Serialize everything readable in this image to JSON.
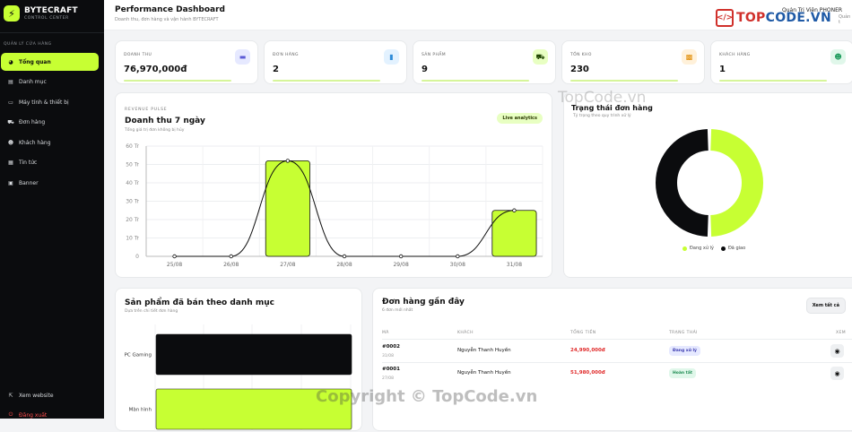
{
  "sidebar": {
    "brand_name": "BYTECRAFT",
    "brand_sub": "CONTROL CENTER",
    "logo_glyph": "⚡",
    "section_label": "QUẢN LÝ CỬA HÀNG",
    "items": [
      {
        "label": "Tổng quan",
        "icon": "pie-chart-icon",
        "glyph": "◕",
        "active": true
      },
      {
        "label": "Danh mục",
        "icon": "folder-icon",
        "glyph": "▤"
      },
      {
        "label": "Máy tính & thiết bị",
        "icon": "computer-icon",
        "glyph": "▭"
      },
      {
        "label": "Đơn hàng",
        "icon": "cart-icon",
        "glyph": "⛟"
      },
      {
        "label": "Khách hàng",
        "icon": "users-icon",
        "glyph": "☻"
      },
      {
        "label": "Tin tức",
        "icon": "news-icon",
        "glyph": "▦"
      },
      {
        "label": "Banner",
        "icon": "image-icon",
        "glyph": "▣"
      }
    ],
    "bottom": [
      {
        "label": "Xem website",
        "icon": "external-icon",
        "glyph": "⇱"
      },
      {
        "label": "Đăng xuất",
        "icon": "logout-icon",
        "glyph": "⏻"
      }
    ]
  },
  "header": {
    "title": "Performance Dashboard",
    "subtitle": "Doanh thu, đơn hàng và vận hành BYTECRAFT",
    "user_name": "Quản Trị Viên PHONER",
    "user_role": "Quản t"
  },
  "watermark": {
    "logo_text_a": "TOP",
    "logo_text_b": "CODE.VN",
    "mid": "TopCode.vn",
    "copyright": "Copyright © TopCode.vn"
  },
  "stats": [
    {
      "label": "DOANH THU",
      "value": "76,970,000đ",
      "icon": "wallet-icon",
      "glyph": "▬",
      "color": "#e6e9ff",
      "fg": "#5b5bd6"
    },
    {
      "label": "ĐƠN HÀNG",
      "value": "2",
      "icon": "bag-icon",
      "glyph": "▮",
      "color": "#e3f2ff",
      "fg": "#2e8bd8"
    },
    {
      "label": "SẢN PHẨM",
      "value": "9",
      "icon": "truck-icon",
      "glyph": "⛟",
      "color": "#e8ffc2",
      "fg": "#1f4400"
    },
    {
      "label": "TỒN KHO",
      "value": "230",
      "icon": "box-icon",
      "glyph": "▩",
      "color": "#fff1da",
      "fg": "#e08a00"
    },
    {
      "label": "KHÁCH HÀNG",
      "value": "1",
      "icon": "users-icon",
      "glyph": "☻",
      "color": "#e0f7ea",
      "fg": "#1b9a5a"
    }
  ],
  "revenue": {
    "kicker": "REVENUE PULSE",
    "title": "Doanh thu 7 ngày",
    "subtitle": "Tổng giá trị đơn không bị hủy",
    "badge": "Live analytics"
  },
  "chart_data": [
    {
      "type": "bar",
      "categories": [
        "25/08",
        "26/08",
        "27/08",
        "28/08",
        "29/08",
        "30/08",
        "31/08"
      ],
      "values": [
        0,
        0,
        52000000,
        0,
        0,
        0,
        25000000
      ],
      "y_ticks": [
        "0",
        "10 Tr",
        "20 Tr",
        "30 Tr",
        "40 Tr",
        "50 Tr",
        "60 Tr"
      ],
      "ylim": [
        0,
        60000000
      ],
      "grid": true,
      "bar_color": "#c7ff33",
      "line_color": "#111111"
    },
    {
      "type": "pie",
      "labels": [
        "Đang xử lý",
        "Đã giao"
      ],
      "values": [
        1,
        1
      ],
      "colors": [
        "#c7ff33",
        "#0b0c0e"
      ]
    },
    {
      "type": "bar",
      "categories": [
        "PC Gaming",
        "Màn hình"
      ],
      "colors": [
        "#0b0c0e",
        "#c7ff33"
      ]
    }
  ],
  "status": {
    "title": "Trạng thái đơn hàng",
    "subtitle": "Tỷ trọng theo quy trình xử lý",
    "legend": [
      "Đang xử lý",
      "Đã giao"
    ]
  },
  "products": {
    "title": "Sản phẩm đã bán theo danh mục",
    "subtitle": "Dựa trên chi tiết đơn hàng"
  },
  "orders": {
    "title": "Đơn hàng gần đây",
    "subtitle": "6 đơn mới nhất",
    "view_all": "Xem tất cả",
    "columns": [
      "MÃ",
      "KHÁCH",
      "TỔNG TIỀN",
      "TRẠNG THÁI",
      "XEM"
    ],
    "rows": [
      {
        "id": "#0002",
        "date": "31/08",
        "customer": "Nguyễn Thanh Huyền",
        "total": "24,990,000đ",
        "status": "Đang xử lý",
        "status_bg": "#e6e9ff",
        "status_fg": "#3b3bb0"
      },
      {
        "id": "#0001",
        "date": "27/08",
        "customer": "Nguyễn Thanh Huyền",
        "total": "51,980,000đ",
        "status": "Hoàn tất",
        "status_bg": "#e0f7ea",
        "status_fg": "#1b8a50"
      }
    ],
    "eye_glyph": "◉"
  }
}
